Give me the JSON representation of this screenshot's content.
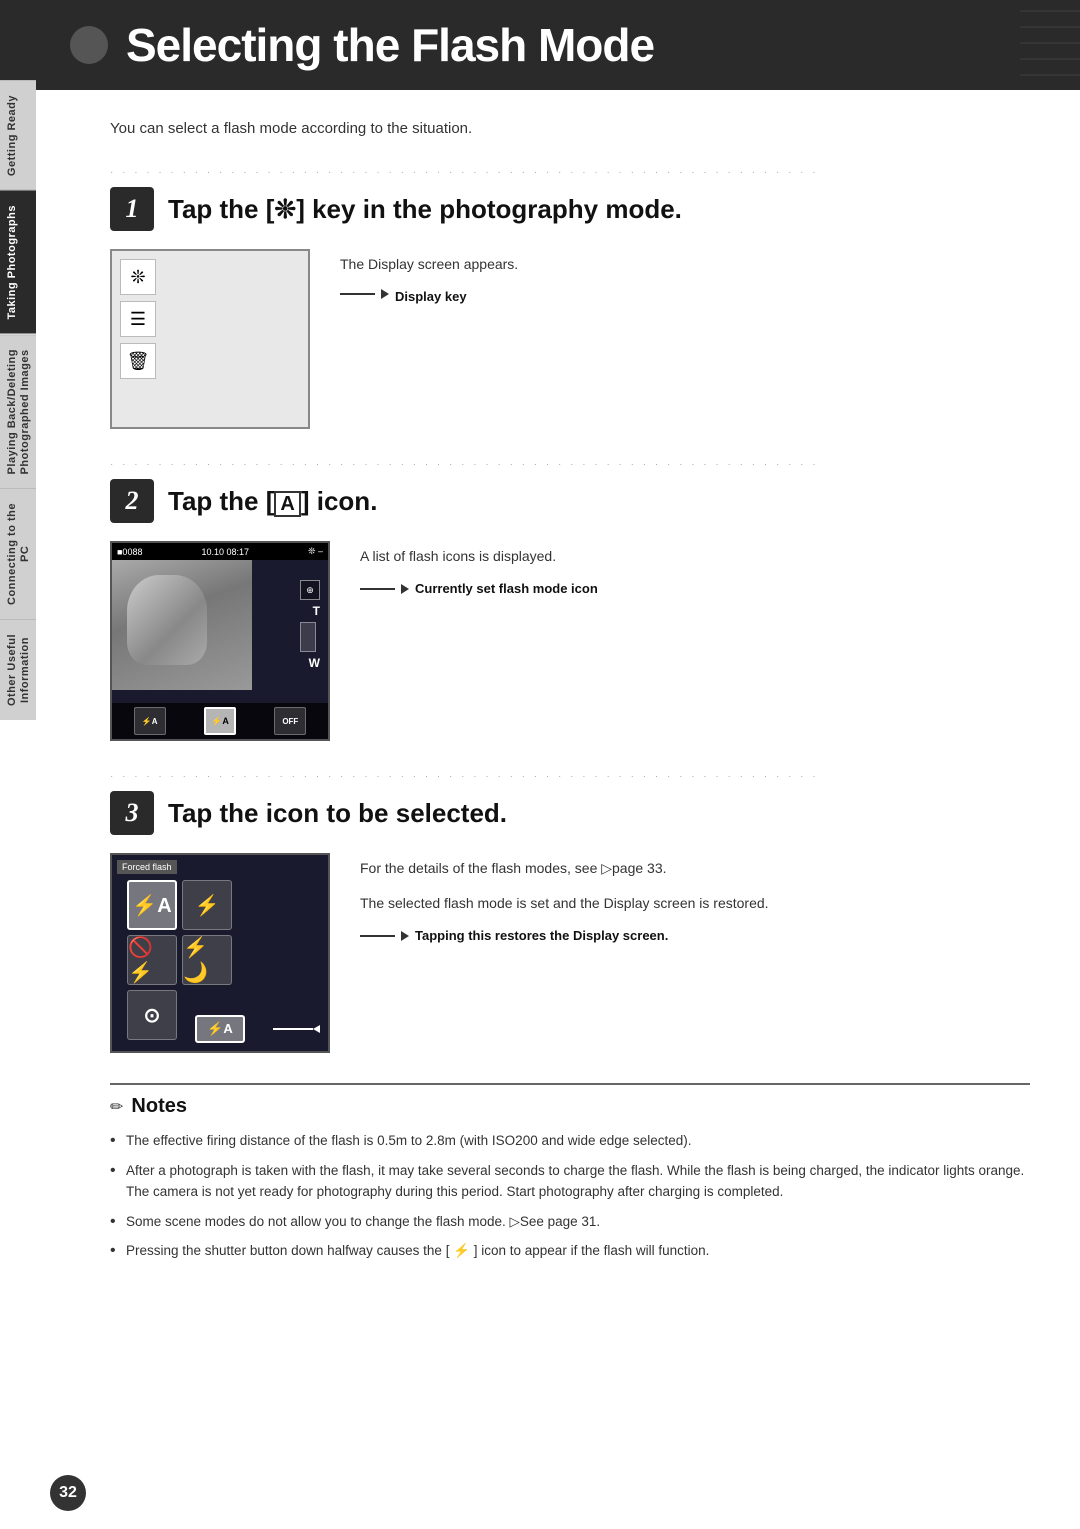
{
  "page": {
    "title": "Selecting the Flash Mode",
    "page_number": "32",
    "intro": "You can select a flash mode according to the situation."
  },
  "side_tabs": [
    {
      "id": "getting-ready",
      "label": "Getting Ready",
      "active": false
    },
    {
      "id": "taking-photos",
      "label": "Taking Photographs",
      "active": true
    },
    {
      "id": "playing-back",
      "label": "Playing Back/Deleting Photographed Images",
      "active": false
    },
    {
      "id": "connecting",
      "label": "Connecting to the PC",
      "active": false
    },
    {
      "id": "other",
      "label": "Other Useful Information",
      "active": false
    }
  ],
  "steps": [
    {
      "number": "1",
      "title": "Tap the [  ] key in the photography mode.",
      "title_icon": "❊",
      "description": "The Display screen appears.",
      "label": "Display key"
    },
    {
      "number": "2",
      "title": "Tap the [  ] icon.",
      "title_icon": "A",
      "description": "A list of flash icons is displayed.",
      "label": "Currently set flash mode icon"
    },
    {
      "number": "3",
      "title": "Tap the icon to be selected.",
      "description_1": "For the details of the flash modes, see ▷page 33.",
      "description_2": "The selected flash mode is set and the Display screen is restored.",
      "label": "Tapping this restores the Display screen."
    }
  ],
  "notes": {
    "title": "Notes",
    "items": [
      "The effective firing distance of the flash is 0.5m to 2.8m (with ISO200 and wide edge selected).",
      "After a photograph is taken with the flash, it may take several seconds to charge the flash. While the flash is being charged, the indicator lights orange. The camera is not yet ready for photography during this period. Start photography after charging is completed.",
      "Some scene modes do not allow you to change the flash mode. ▷See page 31.",
      "Pressing the shutter button down halfway causes the [ ⚡ ] icon to appear if the flash will function."
    ]
  }
}
